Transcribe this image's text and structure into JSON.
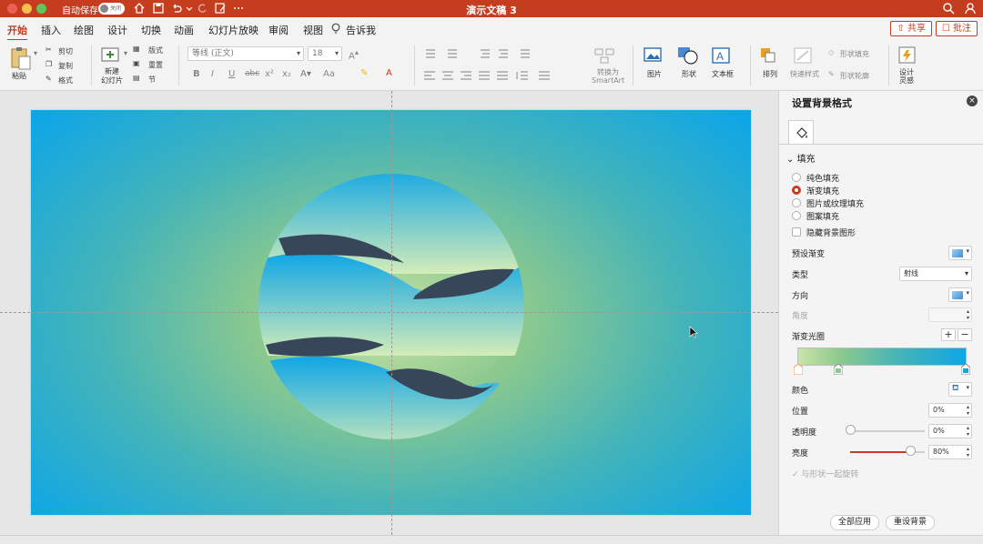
{
  "titlebar": {
    "autosave_label": "自动保存",
    "autosave_state": "关闭",
    "doc_title": "演示文稿 3"
  },
  "tabs": [
    {
      "label": "开始",
      "active": true
    },
    {
      "label": "插入"
    },
    {
      "label": "绘图"
    },
    {
      "label": "设计"
    },
    {
      "label": "切换"
    },
    {
      "label": "动画"
    },
    {
      "label": "幻灯片放映"
    },
    {
      "label": "审阅"
    },
    {
      "label": "视图"
    },
    {
      "label": "告诉我"
    }
  ],
  "share_label": "共享",
  "comment_label": "批注",
  "ribbon": {
    "paste": "粘贴",
    "cut": "剪切",
    "copy": "复制",
    "format": "格式",
    "new_slide": [
      "新建",
      "幻灯片"
    ],
    "layout": "版式",
    "reset": "重置",
    "section": "节",
    "font_name": "等线 (正文)",
    "font_size": "18",
    "bold": "B",
    "italic": "I",
    "underline": "U",
    "strike": "abc",
    "superscript": "x²",
    "subscript": "x₂",
    "change_case": "Aa",
    "convert_smartart": [
      "转换为",
      "SmartArt"
    ],
    "picture": "图片",
    "shape": "形状",
    "textbox": "文本框",
    "arrange": "排列",
    "quick_styles": "快速样式",
    "shape_fill": "形状填充",
    "shape_outline": "形状轮廓",
    "design_ideas": [
      "设计",
      "灵感"
    ]
  },
  "pane": {
    "title": "设置背景格式",
    "fill_section": "填充",
    "options": [
      "纯色填充",
      "渐变填充",
      "图片或纹理填充",
      "图案填充"
    ],
    "selected_option": 1,
    "hide_bg": "隐藏背景图形",
    "preset": "预设渐变",
    "type": "类型",
    "type_value": "射线",
    "direction": "方向",
    "angle": "角度",
    "stops": "渐变光圈",
    "color": "颜色",
    "position": "位置",
    "position_value": "0%",
    "transparency": "透明度",
    "transparency_value": "0%",
    "brightness": "亮度",
    "brightness_value": "80%",
    "rotate_with_shape": "与形状一起旋转",
    "apply_all": "全部应用",
    "reset_bg": "重设背景"
  },
  "colors": {
    "accent": "#c43d1e",
    "wave_dark": "#374659",
    "slide_edge": "#0fa6e6",
    "slide_center": "#c9e4a8"
  },
  "slide_data": {
    "transparency_level": 0,
    "brightness_level": 0.8
  }
}
